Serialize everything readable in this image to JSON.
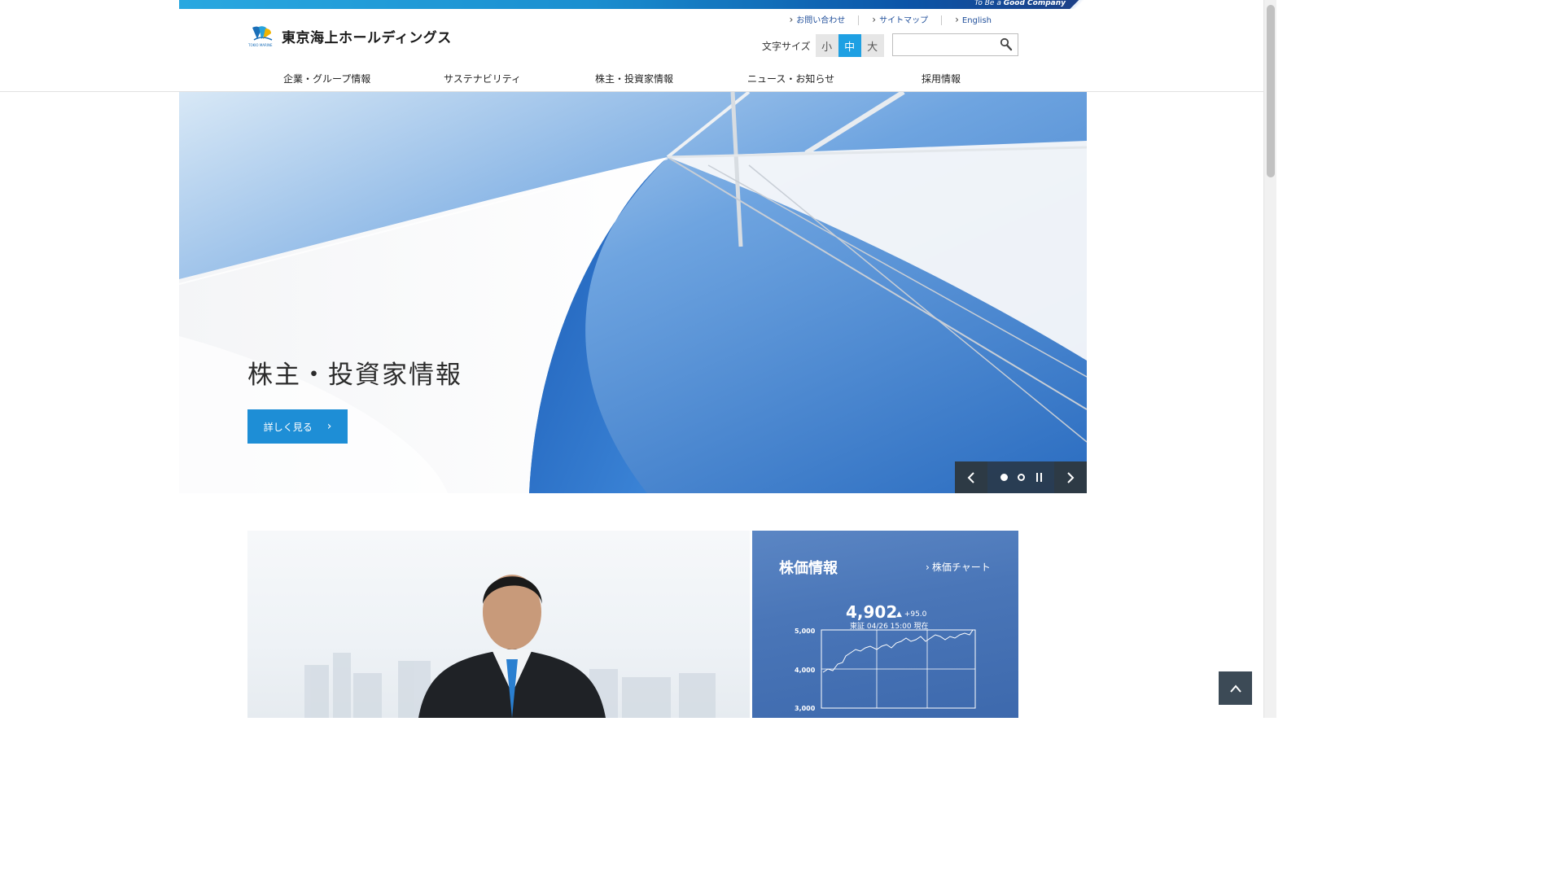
{
  "banner": {
    "tagline_prefix": "To Be a ",
    "tagline_bold": "Good Company"
  },
  "header": {
    "logo_text": "東京海上ホールディングス",
    "logo_small": "TOKIO MARINE",
    "util_links": [
      "お問い合わせ",
      "サイトマップ",
      "English"
    ],
    "font_size": {
      "label": "文字サイズ",
      "options": [
        "小",
        "中",
        "大"
      ],
      "selected": "中"
    },
    "search": {
      "placeholder": "",
      "value": ""
    }
  },
  "nav": [
    "企業・グループ情報",
    "サステナビリティ",
    "株主・投資家情報",
    "ニュース・お知らせ",
    "採用情報"
  ],
  "hero": {
    "title": "株主・投資家情報",
    "button_label": "詳しく見る",
    "slides": 2,
    "active_slide": 1
  },
  "stock": {
    "title": "株価情報",
    "chart_link": "株価チャート",
    "price": "4,902",
    "change": "+95.0",
    "asof": "東証 04/26 15:00 現在",
    "y_ticks": [
      "5,000",
      "4,000",
      "3,000"
    ]
  },
  "colors": {
    "accent": "#1ea0e3",
    "hero_button": "#1e8ed6",
    "link": "#1f4e9a",
    "control_dark": "#2d3a45"
  }
}
